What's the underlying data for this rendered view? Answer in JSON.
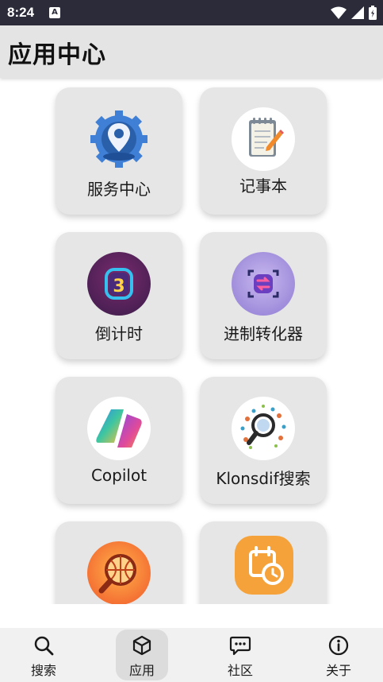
{
  "status_bar": {
    "time": "8:24",
    "notification_icon": "a-icon"
  },
  "app_bar": {
    "title": "应用中心"
  },
  "apps": [
    {
      "label": "服务中心",
      "icon": "location-gear-icon"
    },
    {
      "label": "记事本",
      "icon": "notepad-icon"
    },
    {
      "label": "倒计时",
      "icon": "timer-3-icon"
    },
    {
      "label": "进制转化器",
      "icon": "converter-icon"
    },
    {
      "label": "Copilot",
      "icon": "copilot-icon"
    },
    {
      "label": "Klonsdif搜索",
      "icon": "magnifier-circuit-icon"
    },
    {
      "label": "",
      "icon": "search-globe-icon"
    },
    {
      "label": "",
      "icon": "calendar-clock-icon"
    }
  ],
  "bottom_nav": {
    "items": [
      {
        "label": "搜索",
        "icon": "search-icon"
      },
      {
        "label": "应用",
        "icon": "cube-icon",
        "active": true
      },
      {
        "label": "社区",
        "icon": "chat-icon"
      },
      {
        "label": "关于",
        "icon": "info-icon"
      }
    ]
  },
  "colors": {
    "app_bar_bg": "#e4e4e4",
    "card_bg": "#e6e6e6",
    "status_bar_bg": "#2b2b3a"
  }
}
